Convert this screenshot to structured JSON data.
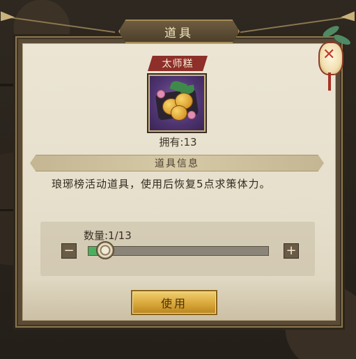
{
  "dialog": {
    "title": "道具"
  },
  "item": {
    "name": "太师糕",
    "owned_text": "拥有:13",
    "icon": "pastry-icon"
  },
  "info": {
    "section_title": "道具信息",
    "description": "琅琊榜活动道具，使用后恢复5点求策体力。"
  },
  "quantity": {
    "label": "数量:1/13",
    "current": 1,
    "max": 13,
    "minus_label": "−",
    "plus_label": "+"
  },
  "actions": {
    "use_label": "使用"
  },
  "colors": {
    "accent_gold": "#d9a73a",
    "name_tag_red": "#8e2f2a",
    "slider_fill": "#4fae5e"
  }
}
